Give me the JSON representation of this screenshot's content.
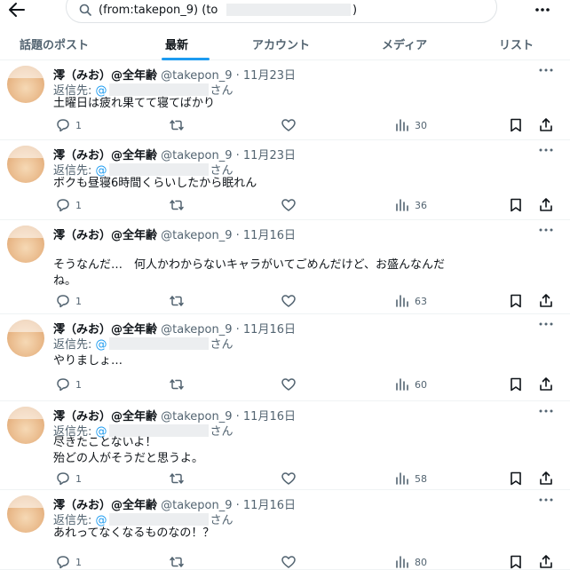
{
  "search": {
    "query_prefix": "(from:takepon_9) (to",
    "query_suffix": ")"
  },
  "tabs": [
    {
      "label": "話題のポスト",
      "active": false
    },
    {
      "label": "最新",
      "active": true
    },
    {
      "label": "アカウント",
      "active": false
    },
    {
      "label": "メディア",
      "active": false
    },
    {
      "label": "リスト",
      "active": false
    }
  ],
  "tweets": [
    {
      "name": "澪（みお）@全年齢",
      "handle": "@takepon_9",
      "date": "11月23日",
      "reply_label": "返信先:",
      "reply_at": "@",
      "reply_suffix": "さん",
      "text": "土曜日は疲れ果てて寝てばかり",
      "replies": "1",
      "views": "30"
    },
    {
      "name": "澪（みお）@全年齢",
      "handle": "@takepon_9",
      "date": "11月23日",
      "reply_label": "返信先:",
      "reply_at": "@",
      "reply_suffix": "さん",
      "text": "ボクも昼寝6時間くらいしたから眠れん",
      "replies": "1",
      "views": "36"
    },
    {
      "name": "澪（みお）@全年齢",
      "handle": "@takepon_9",
      "date": "11月16日",
      "reply_label": "",
      "reply_at": "",
      "reply_suffix": "",
      "text": "そうなんだ…　何人かわからないキャラがいてごめんだけど、お盛んなんだ\nね。",
      "replies": "1",
      "views": "63"
    },
    {
      "name": "澪（みお）@全年齢",
      "handle": "@takepon_9",
      "date": "11月16日",
      "reply_label": "返信先:",
      "reply_at": "@",
      "reply_suffix": "さん",
      "text": "やりましょ…",
      "replies": "1",
      "views": "60"
    },
    {
      "name": "澪（みお）@全年齢",
      "handle": "@takepon_9",
      "date": "11月16日",
      "reply_label": "返信先:",
      "reply_at": "@",
      "reply_suffix": "さん",
      "text": "尽きたことないよ！\n殆どの人がそうだと思うよ。",
      "replies": "1",
      "views": "58"
    },
    {
      "name": "澪（みお）@全年齢",
      "handle": "@takepon_9",
      "date": "11月16日",
      "reply_label": "返信先:",
      "reply_at": "@",
      "reply_suffix": "さん",
      "text": "あれってなくなるものなの！？",
      "replies": "1",
      "views": "80"
    }
  ],
  "colors": {
    "accent": "#1d9bf0",
    "text": "#0f1419",
    "muted": "#536471"
  },
  "icons": {
    "back": "arrow-left-icon",
    "search": "search-icon",
    "more": "more-dots-icon",
    "reply": "reply-icon",
    "repost": "repost-icon",
    "like": "heart-icon",
    "views": "views-icon",
    "bookmark": "bookmark-icon",
    "share": "share-icon"
  }
}
